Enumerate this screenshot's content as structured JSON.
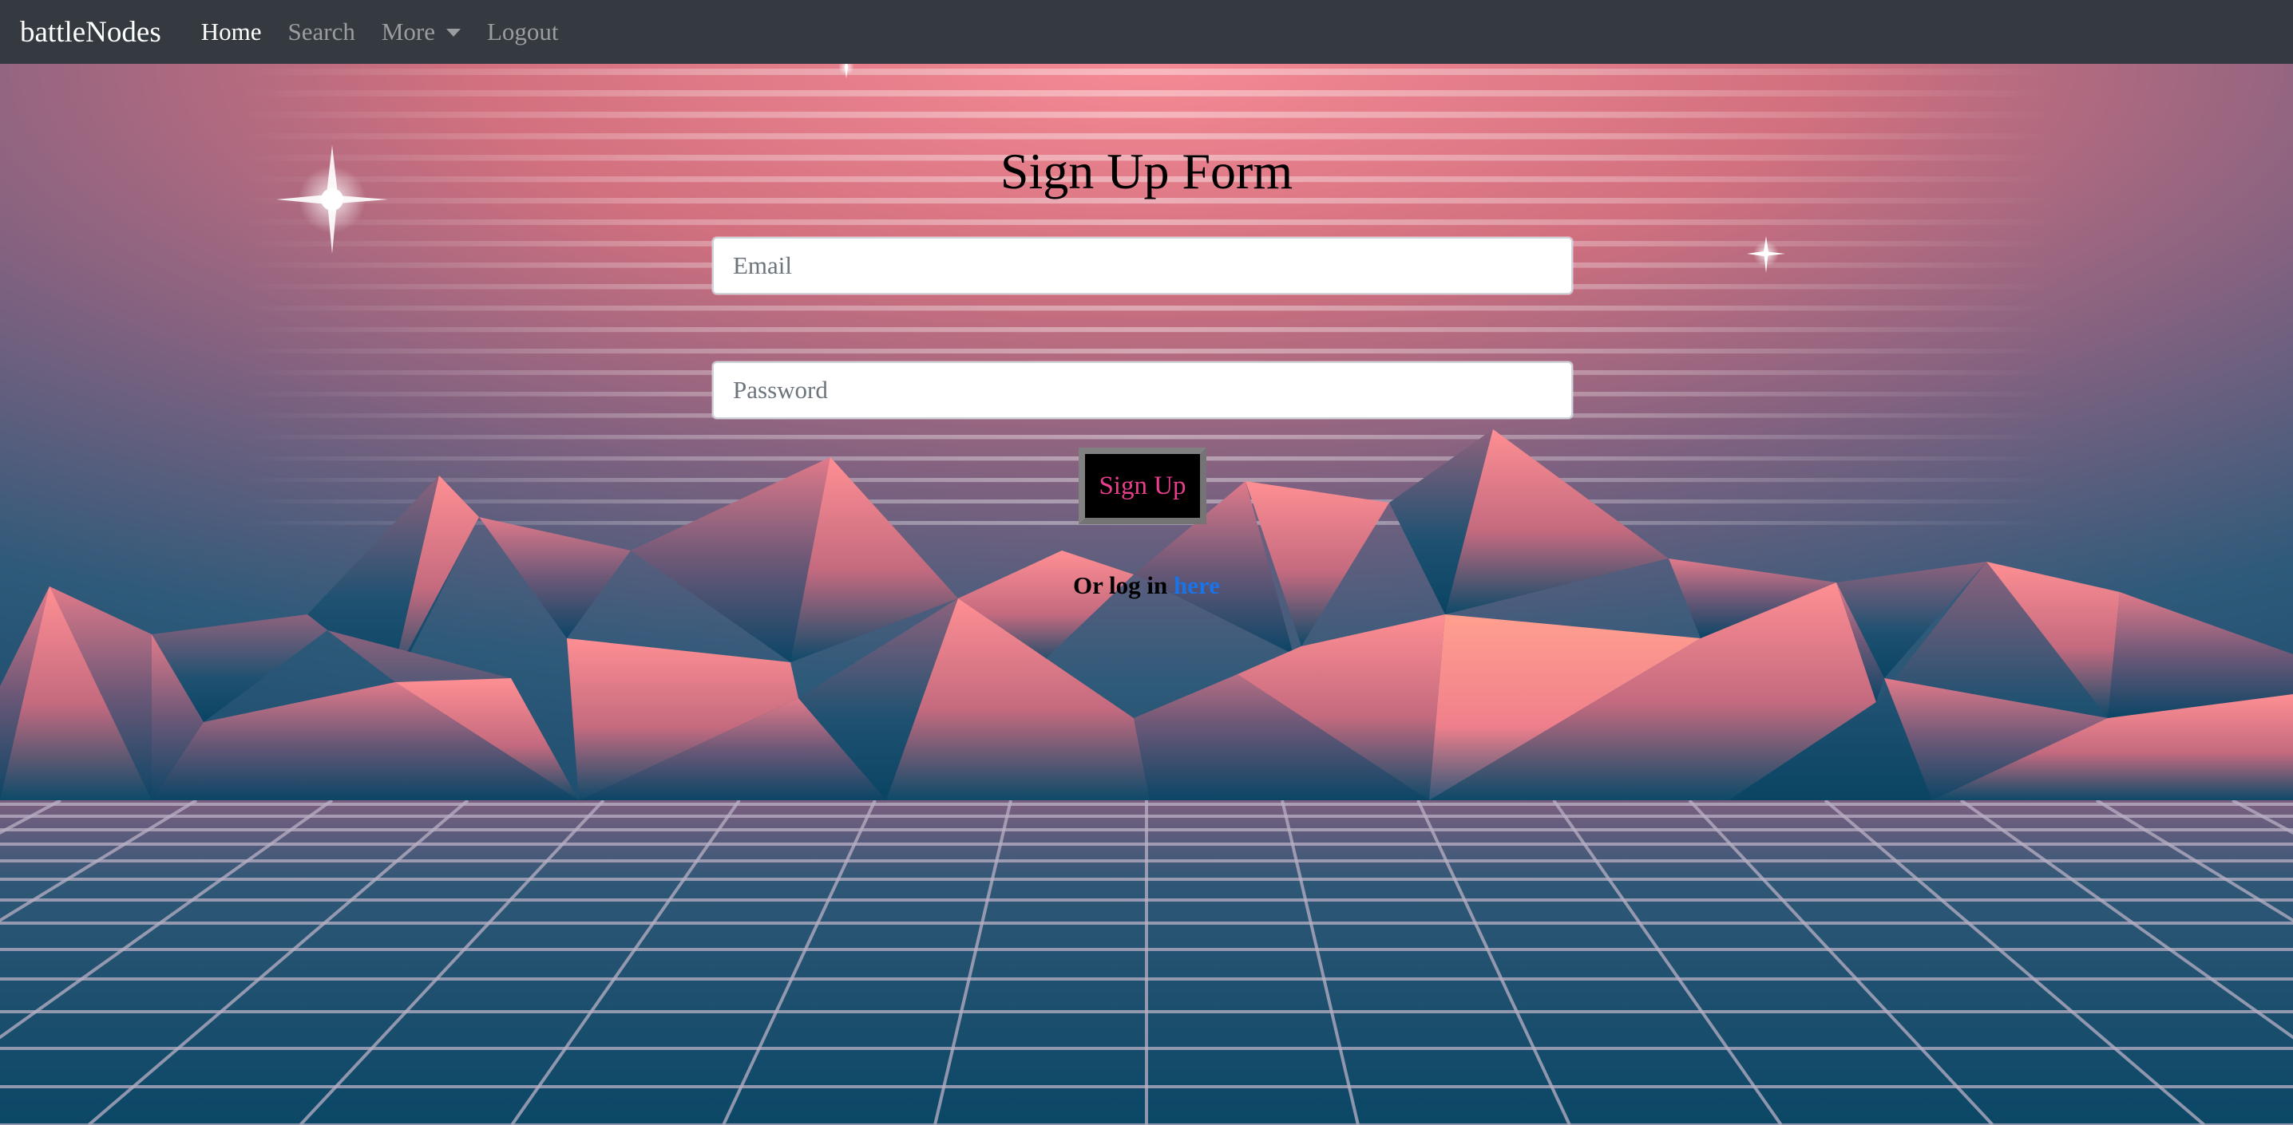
{
  "navbar": {
    "brand": "battleNodes",
    "links": [
      {
        "label": "Home"
      },
      {
        "label": "Search"
      },
      {
        "label": "More"
      },
      {
        "label": "Logout"
      }
    ]
  },
  "form": {
    "title": "Sign Up Form",
    "email_placeholder": "Email",
    "password_placeholder": "Password",
    "submit_label": "Sign Up",
    "login_prefix": "Or log in",
    "login_link": "here"
  },
  "colors": {
    "navbar_bg": "#343a40",
    "sky_top": "#f07e8c",
    "sky_bottom": "#0b4a69",
    "button_text": "#e83e8c",
    "link": "#1a73e8"
  },
  "icons": {
    "dropdown": "chevron-down-icon",
    "sparkle": "star-sparkle-icon"
  }
}
